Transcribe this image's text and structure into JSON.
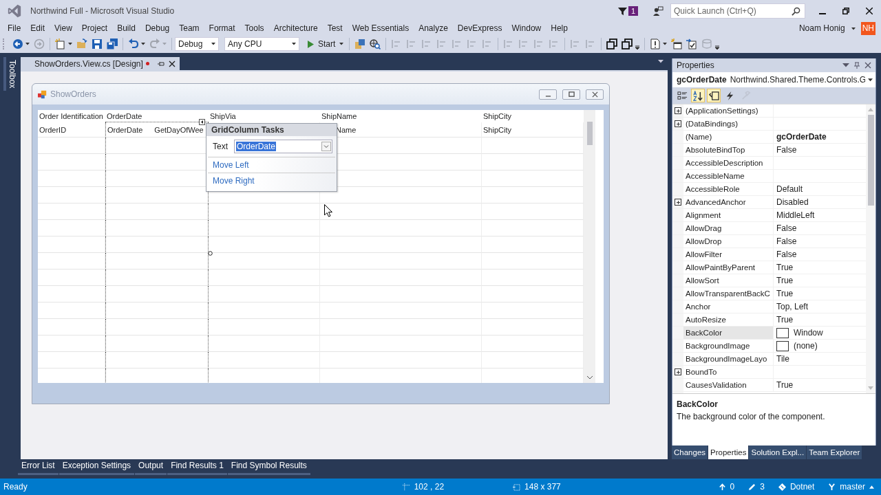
{
  "window": {
    "title": "Northwind Full - Microsoft Visual Studio"
  },
  "notifications": {
    "count": "1"
  },
  "quick_launch": {
    "placeholder": "Quick Launch (Ctrl+Q)"
  },
  "menu": [
    "File",
    "Edit",
    "View",
    "Project",
    "Build",
    "Debug",
    "Team",
    "Format",
    "Tools",
    "Architecture",
    "Test",
    "Web Essentials",
    "Analyze",
    "DevExpress",
    "Window",
    "Help"
  ],
  "user": {
    "name": "Noam Honig",
    "initials": "NH"
  },
  "toolbar": {
    "configuration": "Debug",
    "platform": "Any CPU",
    "start": "Start"
  },
  "document_tabs": [
    {
      "label": "ShowOrders.View.cs [Design]",
      "selected": true,
      "modified": true
    }
  ],
  "toolbox_tab": "Toolbox",
  "form": {
    "title": "ShowOrders",
    "columns": [
      {
        "header": "Order Identification",
        "fields": [
          "OrderID"
        ],
        "selected": false
      },
      {
        "header": "OrderDate",
        "fields": [
          "OrderDate",
          "GetDayOfWee"
        ],
        "selected": true
      },
      {
        "header": "ShipVia",
        "selected": false
      },
      {
        "header": "ShipName",
        "fields": [
          "Name"
        ],
        "selected": false
      },
      {
        "header": "ShipCity",
        "fields": [
          "ShipCity"
        ],
        "selected": false
      }
    ],
    "tasks": {
      "title": "GridColumn Tasks",
      "text_label": "Text",
      "text_value": "OrderDate",
      "actions": [
        "Move Left",
        "Move Right"
      ]
    }
  },
  "properties": {
    "title": "Properties",
    "object_name": "gcOrderDate",
    "object_type": "Northwind.Shared.Theme.Controls.G",
    "view_buttons": [
      {
        "kind": "categorized",
        "selected": false,
        "disabled": false
      },
      {
        "kind": "alphabetical",
        "selected": true,
        "disabled": false
      },
      {
        "kind": "properties",
        "selected": true,
        "disabled": false
      },
      {
        "kind": "events",
        "selected": false,
        "disabled": false
      },
      {
        "kind": "pages",
        "selected": false,
        "disabled": true
      }
    ],
    "rows": [
      {
        "name": "(ApplicationSettings)",
        "value": "",
        "expandable": true,
        "swatch": false,
        "selected": false
      },
      {
        "name": "(DataBindings)",
        "value": "",
        "expandable": true,
        "swatch": false,
        "selected": false
      },
      {
        "name": "(Name)",
        "value": "gcOrderDate",
        "expandable": false,
        "modified": true,
        "swatch": false,
        "selected": false
      },
      {
        "name": "AbsoluteBindTop",
        "value": "False",
        "expandable": false,
        "modified": false,
        "swatch": false,
        "selected": false
      },
      {
        "name": "AccessibleDescription",
        "value": "",
        "expandable": false,
        "swatch": false,
        "selected": false
      },
      {
        "name": "AccessibleName",
        "value": "",
        "expandable": false,
        "swatch": false,
        "selected": false
      },
      {
        "name": "AccessibleRole",
        "value": "Default",
        "expandable": false,
        "modified": false,
        "swatch": false,
        "selected": false
      },
      {
        "name": "AdvancedAnchor",
        "value": "Disabled",
        "expandable": true,
        "modified": false,
        "swatch": false,
        "selected": false
      },
      {
        "name": "Alignment",
        "value": "MiddleLeft",
        "expandable": false,
        "modified": false,
        "swatch": false,
        "selected": false
      },
      {
        "name": "AllowDrag",
        "value": "False",
        "expandable": false,
        "modified": false,
        "swatch": false,
        "selected": false
      },
      {
        "name": "AllowDrop",
        "value": "False",
        "expandable": false,
        "modified": false,
        "swatch": false,
        "selected": false
      },
      {
        "name": "AllowFilter",
        "value": "False",
        "expandable": false,
        "modified": false,
        "swatch": false,
        "selected": false
      },
      {
        "name": "AllowPaintByParent",
        "value": "True",
        "expandable": false,
        "modified": false,
        "swatch": false,
        "selected": false
      },
      {
        "name": "AllowSort",
        "value": "True",
        "expandable": false,
        "modified": false,
        "swatch": false,
        "selected": false
      },
      {
        "name": "AllowTransparentBackC",
        "value": "True",
        "expandable": false,
        "modified": false,
        "swatch": false,
        "selected": false
      },
      {
        "name": "Anchor",
        "value": "Top, Left",
        "expandable": false,
        "modified": false,
        "swatch": false,
        "selected": false
      },
      {
        "name": "AutoResize",
        "value": "True",
        "expandable": false,
        "modified": false,
        "swatch": false,
        "selected": false
      },
      {
        "name": "BackColor",
        "value": "Window",
        "expandable": false,
        "modified": false,
        "swatch": true,
        "selected": true
      },
      {
        "name": "BackgroundImage",
        "value": "(none)",
        "expandable": false,
        "modified": false,
        "swatch": true,
        "selected": false
      },
      {
        "name": "BackgroundImageLayo",
        "value": "Tile",
        "expandable": false,
        "modified": false,
        "swatch": false,
        "selected": false
      },
      {
        "name": "BoundTo",
        "value": "",
        "expandable": true,
        "swatch": false,
        "selected": false
      },
      {
        "name": "CausesValidation",
        "value": "True",
        "expandable": false,
        "modified": false,
        "swatch": false,
        "selected": false
      }
    ],
    "description": {
      "title": "BackColor",
      "text": "The background color of the component."
    },
    "tabs": [
      {
        "label": "Changes",
        "selected": false
      },
      {
        "label": "Properties",
        "selected": true
      },
      {
        "label": "Solution Expl...",
        "selected": false
      },
      {
        "label": "Team Explorer",
        "selected": false
      }
    ]
  },
  "bottom_tabs": [
    "Error List",
    "Exception Settings",
    "Output",
    "Find Results 1",
    "Find Symbol Results"
  ],
  "status_bar": {
    "text": "Ready",
    "position": "102 , 22",
    "size": "148 x 377",
    "outgoing": "0",
    "changes": "3",
    "repository": "Dotnet",
    "branch": "master"
  }
}
